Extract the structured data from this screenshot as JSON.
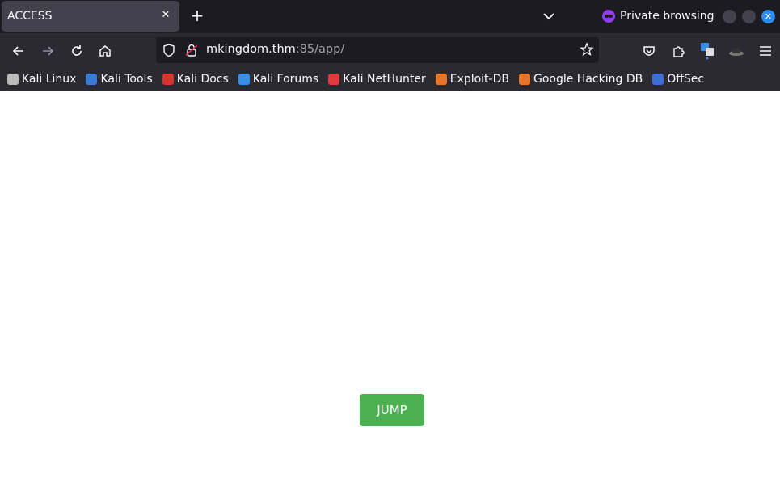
{
  "tab": {
    "title": "ACCESS",
    "close_glyph": "✕"
  },
  "new_tab_glyph": "+",
  "private_label": "Private browsing",
  "address": {
    "host": "mkingdom.thm",
    "rest": ":85/app/"
  },
  "bookmarks": [
    {
      "label": "Kali Linux",
      "icon": "kali-dragon-icon",
      "color": "#bbbbbb"
    },
    {
      "label": "Kali Tools",
      "icon": "kali-tools-icon",
      "color": "#3a7bd5"
    },
    {
      "label": "Kali Docs",
      "icon": "kali-docs-icon",
      "color": "#d9332e"
    },
    {
      "label": "Kali Forums",
      "icon": "kali-forums-icon",
      "color": "#3a8ee6"
    },
    {
      "label": "Kali NetHunter",
      "icon": "kali-nethunter-icon",
      "color": "#e0393e"
    },
    {
      "label": "Exploit-DB",
      "icon": "exploit-db-icon",
      "color": "#e8742a"
    },
    {
      "label": "Google Hacking DB",
      "icon": "ghdb-icon",
      "color": "#e8742a"
    },
    {
      "label": "OffSec",
      "icon": "offsec-icon",
      "color": "#3c6fd6"
    }
  ],
  "page": {
    "button_label": "JUMP",
    "button_color": "#4caf50"
  }
}
